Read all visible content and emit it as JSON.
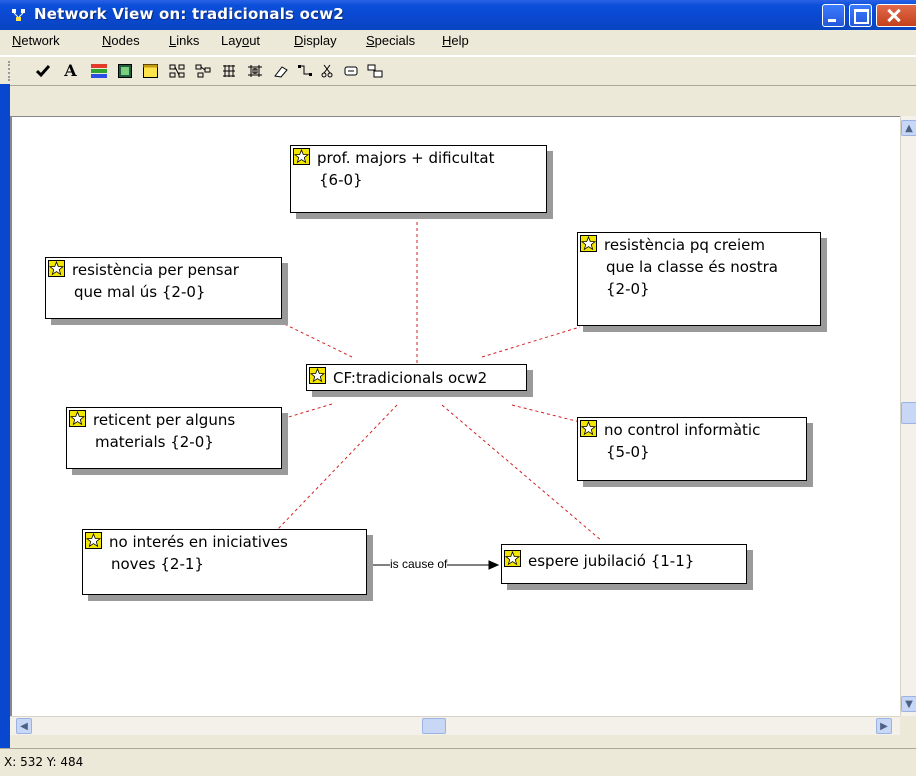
{
  "window": {
    "title": "Network View on: tradicionals ocw2"
  },
  "menu": [
    "Network",
    "Nodes",
    "Links",
    "Layout",
    "Display",
    "Specials",
    "Help"
  ],
  "menu_underline": [
    "N",
    "N",
    "L",
    "o",
    "D",
    "S",
    "H"
  ],
  "toolbar": [
    "check-icon",
    "font-icon",
    "color-icon",
    "image-icon",
    "window-icon",
    "layout-tree-icon",
    "layout-grid-icon",
    "layout-spring-icon",
    "layout-radial-icon",
    "erase-icon",
    "link-icon",
    "cut-icon",
    "comment-icon",
    "arrange-icon"
  ],
  "network": {
    "center": {
      "label": "CF:tradicionals ocw2"
    },
    "nodes": [
      {
        "id": "n1",
        "line1": "prof. majors + dificultat",
        "line2": "{6-0}"
      },
      {
        "id": "n2",
        "line1": "resistència per pensar",
        "line2": "que mal ús {2-0}"
      },
      {
        "id": "n3",
        "line1": "resistència pq creiem",
        "line2": "que la classe és nostra",
        "line3": "{2-0}"
      },
      {
        "id": "n4",
        "line1": "reticent per alguns",
        "line2": "materials {2-0}"
      },
      {
        "id": "n5",
        "line1": "no control informàtic",
        "line2": "{5-0}"
      },
      {
        "id": "n6",
        "line1": "no interés en iniciatives",
        "line2": "noves {2-1}"
      },
      {
        "id": "n7",
        "line1": "espere jubilació {1-1}"
      }
    ],
    "link_label": "is cause of"
  },
  "status": {
    "coords": "X: 532 Y: 484"
  },
  "colors": {
    "titlebar": "#0a47cf",
    "link": "#d32222",
    "node_icon": "#f2e600"
  }
}
